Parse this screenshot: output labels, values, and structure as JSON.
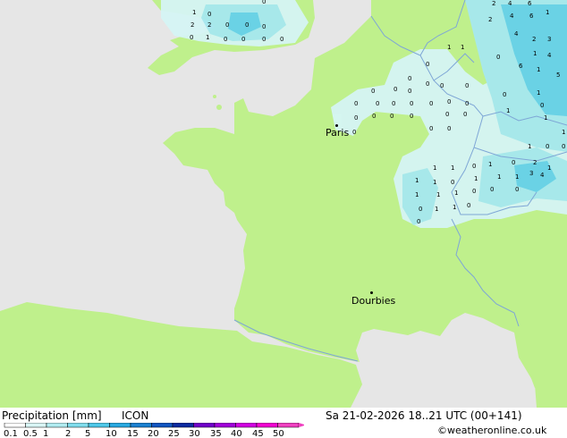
{
  "colors": {
    "sea": "#e6e6e6",
    "land": "#bff08c",
    "precip_light": "#d6f5f5",
    "precip_mid": "#a6e8f0",
    "precip_heavy": "#66d1ea",
    "border": "#6e9bcf"
  },
  "cities": [
    {
      "name": "Paris"
    },
    {
      "name": "Dourbies"
    }
  ],
  "legend": {
    "title": "Precipitation [mm]",
    "model": "ICON",
    "datetime": "Sa 21-02-2026 18..21 UTC (00+141)",
    "copyright": "©weatheronline.co.uk",
    "scale_labels": [
      "0.1",
      "0.5",
      "1",
      "2",
      "5",
      "10",
      "15",
      "20",
      "25",
      "30",
      "35",
      "40",
      "45",
      "50"
    ],
    "scale_colors": [
      "#ffffff",
      "#d9f5f5",
      "#b0ebf0",
      "#80dcec",
      "#4ec7e8",
      "#28a8e0",
      "#1a80d0",
      "#1055c0",
      "#0a2aa0",
      "#7000c8",
      "#a000d8",
      "#d000e0",
      "#f000d0",
      "#f040c0"
    ]
  }
}
